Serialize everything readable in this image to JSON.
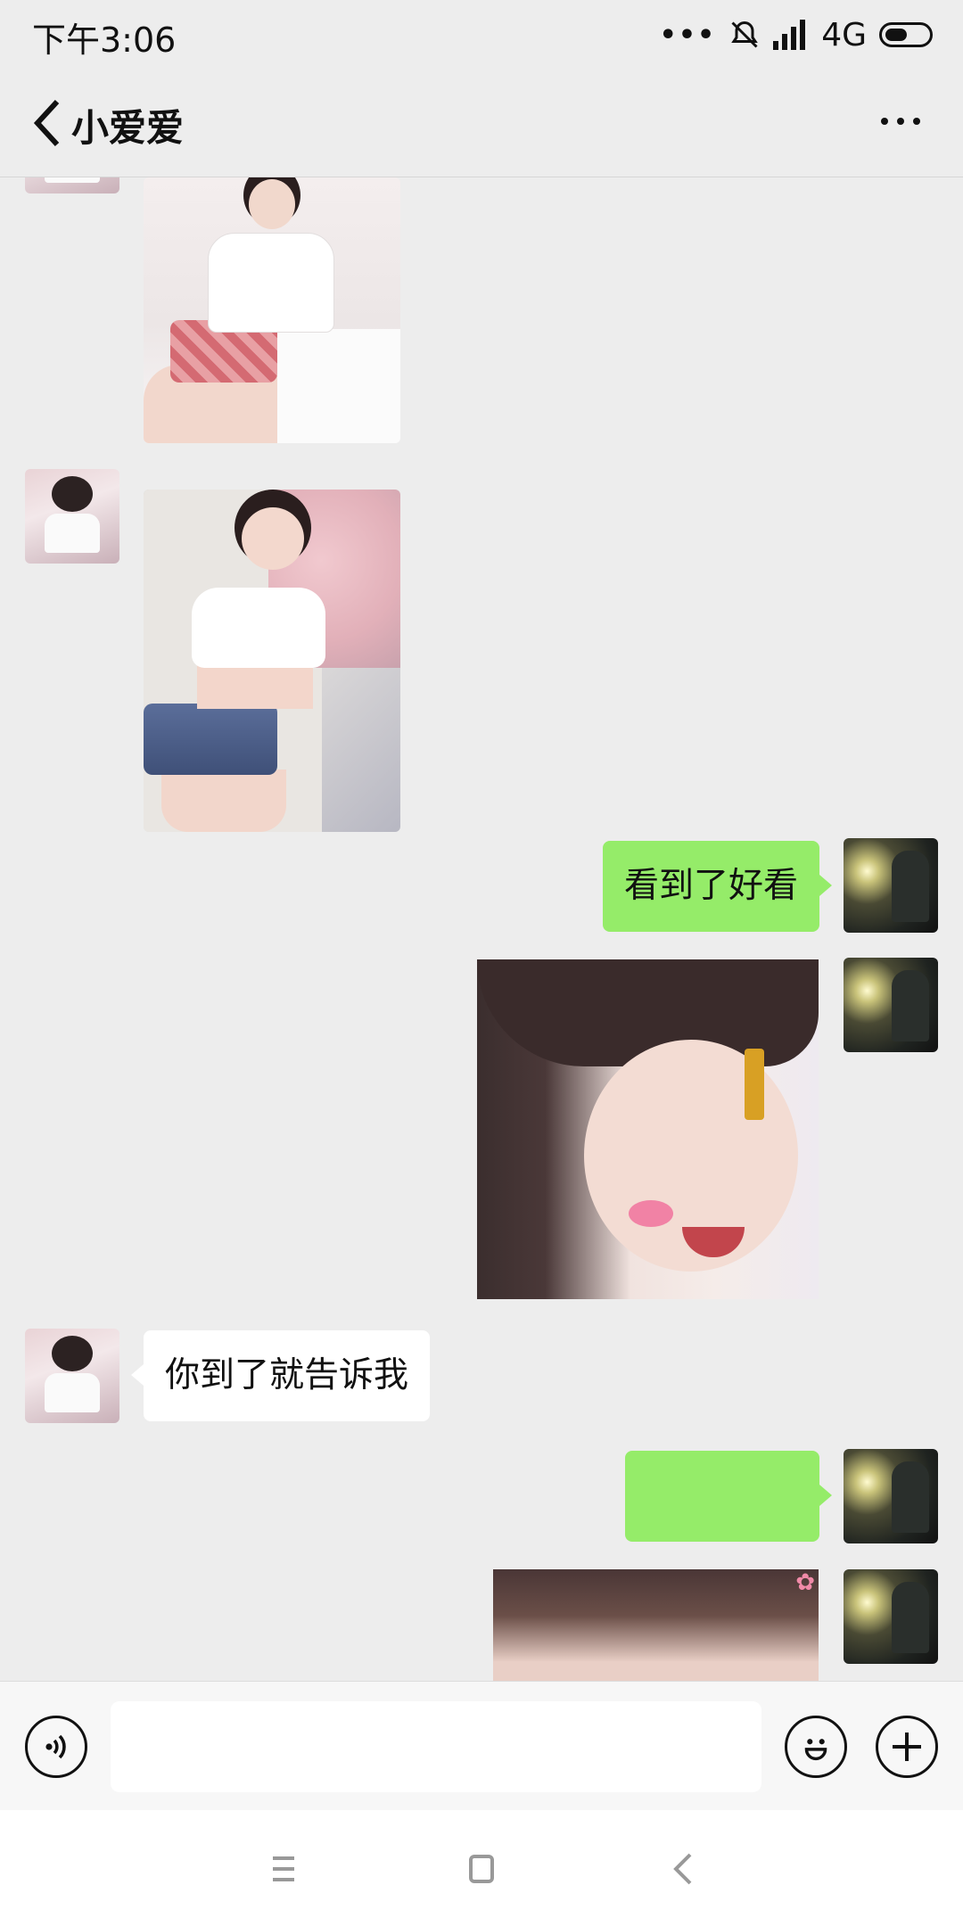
{
  "status_bar": {
    "time": "下午3:06",
    "dots": "•••",
    "network": "4G"
  },
  "header": {
    "title": "小爱爱"
  },
  "messages": [
    {
      "from": "contact",
      "type": "image"
    },
    {
      "from": "contact",
      "type": "image"
    },
    {
      "from": "me",
      "type": "text",
      "text": "看到了好看"
    },
    {
      "from": "me",
      "type": "sticker"
    },
    {
      "from": "contact",
      "type": "text",
      "text": "你到了就告诉我"
    },
    {
      "from": "me",
      "type": "text",
      "text": ""
    },
    {
      "from": "me",
      "type": "sticker"
    }
  ],
  "input_bar": {
    "message_value": ""
  },
  "colors": {
    "background": "#ededed",
    "my_bubble": "#95ec69",
    "their_bubble": "#ffffff"
  },
  "icons": {
    "back": "chevron-left-icon",
    "more": "more-dots-icon",
    "voice": "voice-icon",
    "emoji": "emoji-icon",
    "plus": "plus-icon",
    "mute": "bell-off-icon",
    "signal": "signal-icon",
    "battery": "battery-icon"
  }
}
